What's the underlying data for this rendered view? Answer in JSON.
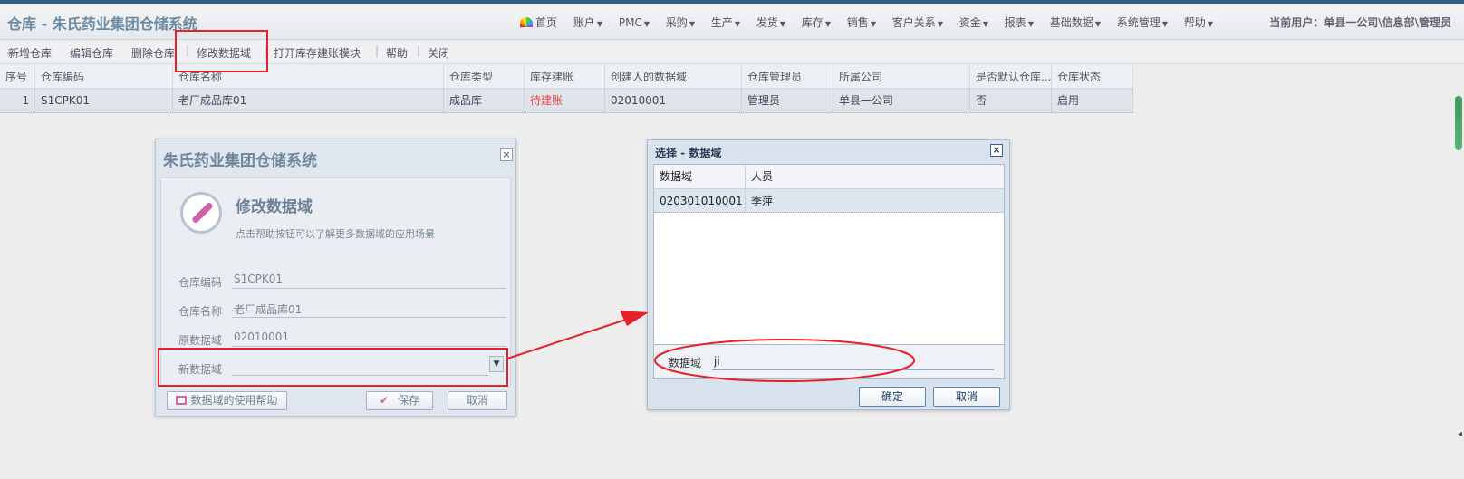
{
  "header": {
    "title": "仓库 - 朱氏药业集团仓储系统",
    "menu": [
      {
        "label": "首页",
        "icon": "rainbow-home-icon",
        "dropdown": false
      },
      {
        "label": "账户",
        "dropdown": true
      },
      {
        "label": "PMC",
        "dropdown": true
      },
      {
        "label": "采购",
        "dropdown": true
      },
      {
        "label": "生产",
        "dropdown": true
      },
      {
        "label": "发货",
        "dropdown": true
      },
      {
        "label": "库存",
        "dropdown": true
      },
      {
        "label": "销售",
        "dropdown": true
      },
      {
        "label": "客户关系",
        "dropdown": true
      },
      {
        "label": "资金",
        "dropdown": true
      },
      {
        "label": "报表",
        "dropdown": true
      },
      {
        "label": "基础数据",
        "dropdown": true
      },
      {
        "label": "系统管理",
        "dropdown": true
      },
      {
        "label": "帮助",
        "dropdown": true
      }
    ],
    "current_user": "当前用户：单县一公司\\信息部\\管理员"
  },
  "toolbar": {
    "items": [
      "新增仓库",
      "编辑仓库",
      "删除仓库",
      "修改数据域",
      "打开库存建账模块",
      "帮助",
      "关闭"
    ]
  },
  "grid": {
    "columns": [
      "序号",
      "仓库编码",
      "仓库名称",
      "仓库类型",
      "库存建账",
      "创建人的数据域",
      "仓库管理员",
      "所属公司",
      "是否默认仓库...",
      "仓库状态"
    ],
    "rows": [
      [
        "1",
        "S1CPK01",
        "老厂成品库01",
        "成品库",
        "待建账",
        "02010001",
        "管理员",
        "单县一公司",
        "否",
        "启用"
      ]
    ]
  },
  "dialog_modify": {
    "window_title": "朱氏药业集团仓储系统",
    "icon": "compass-icon",
    "heading": "修改数据域",
    "subtitle": "点击帮助按钮可以了解更多数据域的应用场景",
    "fields": {
      "code_label": "仓库编码",
      "code_value": "S1CPK01",
      "name_label": "仓库名称",
      "name_value": "老厂成品库01",
      "orig_label": "原数据域",
      "orig_value": "02010001",
      "new_label": "新数据域",
      "new_value": ""
    },
    "help_button": "数据域的使用帮助",
    "save_button": "保存",
    "cancel_button": "取消"
  },
  "dialog_select": {
    "window_title": "选择 - 数据域",
    "columns": [
      "数据域",
      "人员"
    ],
    "rows": [
      [
        "020301010001",
        "季萍"
      ]
    ],
    "search_label": "数据域",
    "search_value": "ji",
    "ok_button": "确定",
    "cancel_button": "取消"
  },
  "colors": {
    "annotation": "#e8202a",
    "header_title": "#6b8aa3",
    "pending_status": "#e64545"
  }
}
